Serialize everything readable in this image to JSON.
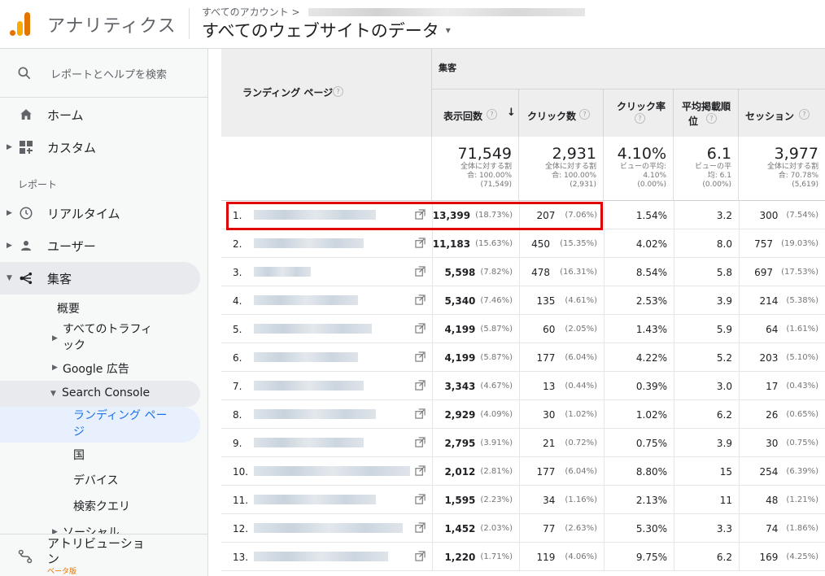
{
  "header": {
    "app_title": "アナリティクス",
    "account_label": "すべてのアカウント >",
    "view_title": "すべてのウェブサイトのデータ",
    "caret": "▾"
  },
  "sidebar": {
    "search_placeholder": "レポートとヘルプを検索",
    "home": "ホーム",
    "custom": "カスタム",
    "reports_section": "レポート",
    "realtime": "リアルタイム",
    "users": "ユーザー",
    "acquisition": "集客",
    "overview": "概要",
    "all_traffic_1": "すべてのトラフィ",
    "all_traffic_2": "ック",
    "google_ads": "Google 広告",
    "search_console": "Search Console",
    "landing_pages_1": "ランディング ペー",
    "landing_pages_2": "ジ",
    "countries": "国",
    "devices": "デバイス",
    "queries": "検索クエリ",
    "social": "ソーシャル",
    "attribution_1": "アトリビューショ",
    "attribution_2": "ン",
    "beta": "ベータ版"
  },
  "table": {
    "landing_page_header": "ランディング ページ",
    "group_header": "集客",
    "columns": {
      "impressions": "表示回数",
      "clicks": "クリック数",
      "ctr": "クリック率",
      "avg_position_1": "平均掲載順",
      "avg_position_2": "位",
      "sessions": "セッション"
    },
    "sort_indicator": "↓",
    "help": "?",
    "totals": {
      "impressions": {
        "value": "71,549",
        "l1": "全体に対する割",
        "l2": "合: 100.00%",
        "l3": "(71,549)"
      },
      "clicks": {
        "value": "2,931",
        "l1": "全体に対する割",
        "l2": "合: 100.00%",
        "l3": "(2,931)"
      },
      "ctr": {
        "value": "4.10%",
        "l1": "ビューの平均:",
        "l2": "4.10%",
        "l3": "(0.00%)"
      },
      "position": {
        "value": "6.1",
        "l1": "ビューの平",
        "l2": "均: 6.1",
        "l3": "(0.00%)"
      },
      "sessions": {
        "value": "3,977",
        "l1": "全体に対する割",
        "l2": "合: 70.78%",
        "l3": "(5,619)"
      }
    },
    "rows": [
      {
        "idx": "1.",
        "imp": "13,399",
        "imp_pct": "(18.73%)",
        "clk": "207",
        "clk_pct": "(7.06%)",
        "ctr": "1.54%",
        "pos": "3.2",
        "ses": "300",
        "ses_pct": "(7.54%)"
      },
      {
        "idx": "2.",
        "imp": "11,183",
        "imp_pct": "(15.63%)",
        "clk": "450",
        "clk_pct": "(15.35%)",
        "ctr": "4.02%",
        "pos": "8.0",
        "ses": "757",
        "ses_pct": "(19.03%)"
      },
      {
        "idx": "3.",
        "imp": "5,598",
        "imp_pct": "(7.82%)",
        "clk": "478",
        "clk_pct": "(16.31%)",
        "ctr": "8.54%",
        "pos": "5.8",
        "ses": "697",
        "ses_pct": "(17.53%)"
      },
      {
        "idx": "4.",
        "imp": "5,340",
        "imp_pct": "(7.46%)",
        "clk": "135",
        "clk_pct": "(4.61%)",
        "ctr": "2.53%",
        "pos": "3.9",
        "ses": "214",
        "ses_pct": "(5.38%)"
      },
      {
        "idx": "5.",
        "imp": "4,199",
        "imp_pct": "(5.87%)",
        "clk": "60",
        "clk_pct": "(2.05%)",
        "ctr": "1.43%",
        "pos": "5.9",
        "ses": "64",
        "ses_pct": "(1.61%)"
      },
      {
        "idx": "6.",
        "imp": "4,199",
        "imp_pct": "(5.87%)",
        "clk": "177",
        "clk_pct": "(6.04%)",
        "ctr": "4.22%",
        "pos": "5.2",
        "ses": "203",
        "ses_pct": "(5.10%)"
      },
      {
        "idx": "7.",
        "imp": "3,343",
        "imp_pct": "(4.67%)",
        "clk": "13",
        "clk_pct": "(0.44%)",
        "ctr": "0.39%",
        "pos": "3.0",
        "ses": "17",
        "ses_pct": "(0.43%)"
      },
      {
        "idx": "8.",
        "imp": "2,929",
        "imp_pct": "(4.09%)",
        "clk": "30",
        "clk_pct": "(1.02%)",
        "ctr": "1.02%",
        "pos": "6.2",
        "ses": "26",
        "ses_pct": "(0.65%)"
      },
      {
        "idx": "9.",
        "imp": "2,795",
        "imp_pct": "(3.91%)",
        "clk": "21",
        "clk_pct": "(0.72%)",
        "ctr": "0.75%",
        "pos": "3.9",
        "ses": "30",
        "ses_pct": "(0.75%)"
      },
      {
        "idx": "10.",
        "imp": "2,012",
        "imp_pct": "(2.81%)",
        "clk": "177",
        "clk_pct": "(6.04%)",
        "ctr": "8.80%",
        "pos": "15",
        "ses": "254",
        "ses_pct": "(6.39%)"
      },
      {
        "idx": "11.",
        "imp": "1,595",
        "imp_pct": "(2.23%)",
        "clk": "34",
        "clk_pct": "(1.16%)",
        "ctr": "2.13%",
        "pos": "11",
        "ses": "48",
        "ses_pct": "(1.21%)"
      },
      {
        "idx": "12.",
        "imp": "1,452",
        "imp_pct": "(2.03%)",
        "clk": "77",
        "clk_pct": "(2.63%)",
        "ctr": "5.30%",
        "pos": "3.3",
        "ses": "74",
        "ses_pct": "(1.86%)"
      },
      {
        "idx": "13.",
        "imp": "1,220",
        "imp_pct": "(1.71%)",
        "clk": "119",
        "clk_pct": "(4.06%)",
        "ctr": "9.75%",
        "pos": "6.2",
        "ses": "169",
        "ses_pct": "(4.25%)"
      }
    ]
  },
  "colors": {
    "accent_orange": "#e37400",
    "highlight_red": "#e00000"
  }
}
